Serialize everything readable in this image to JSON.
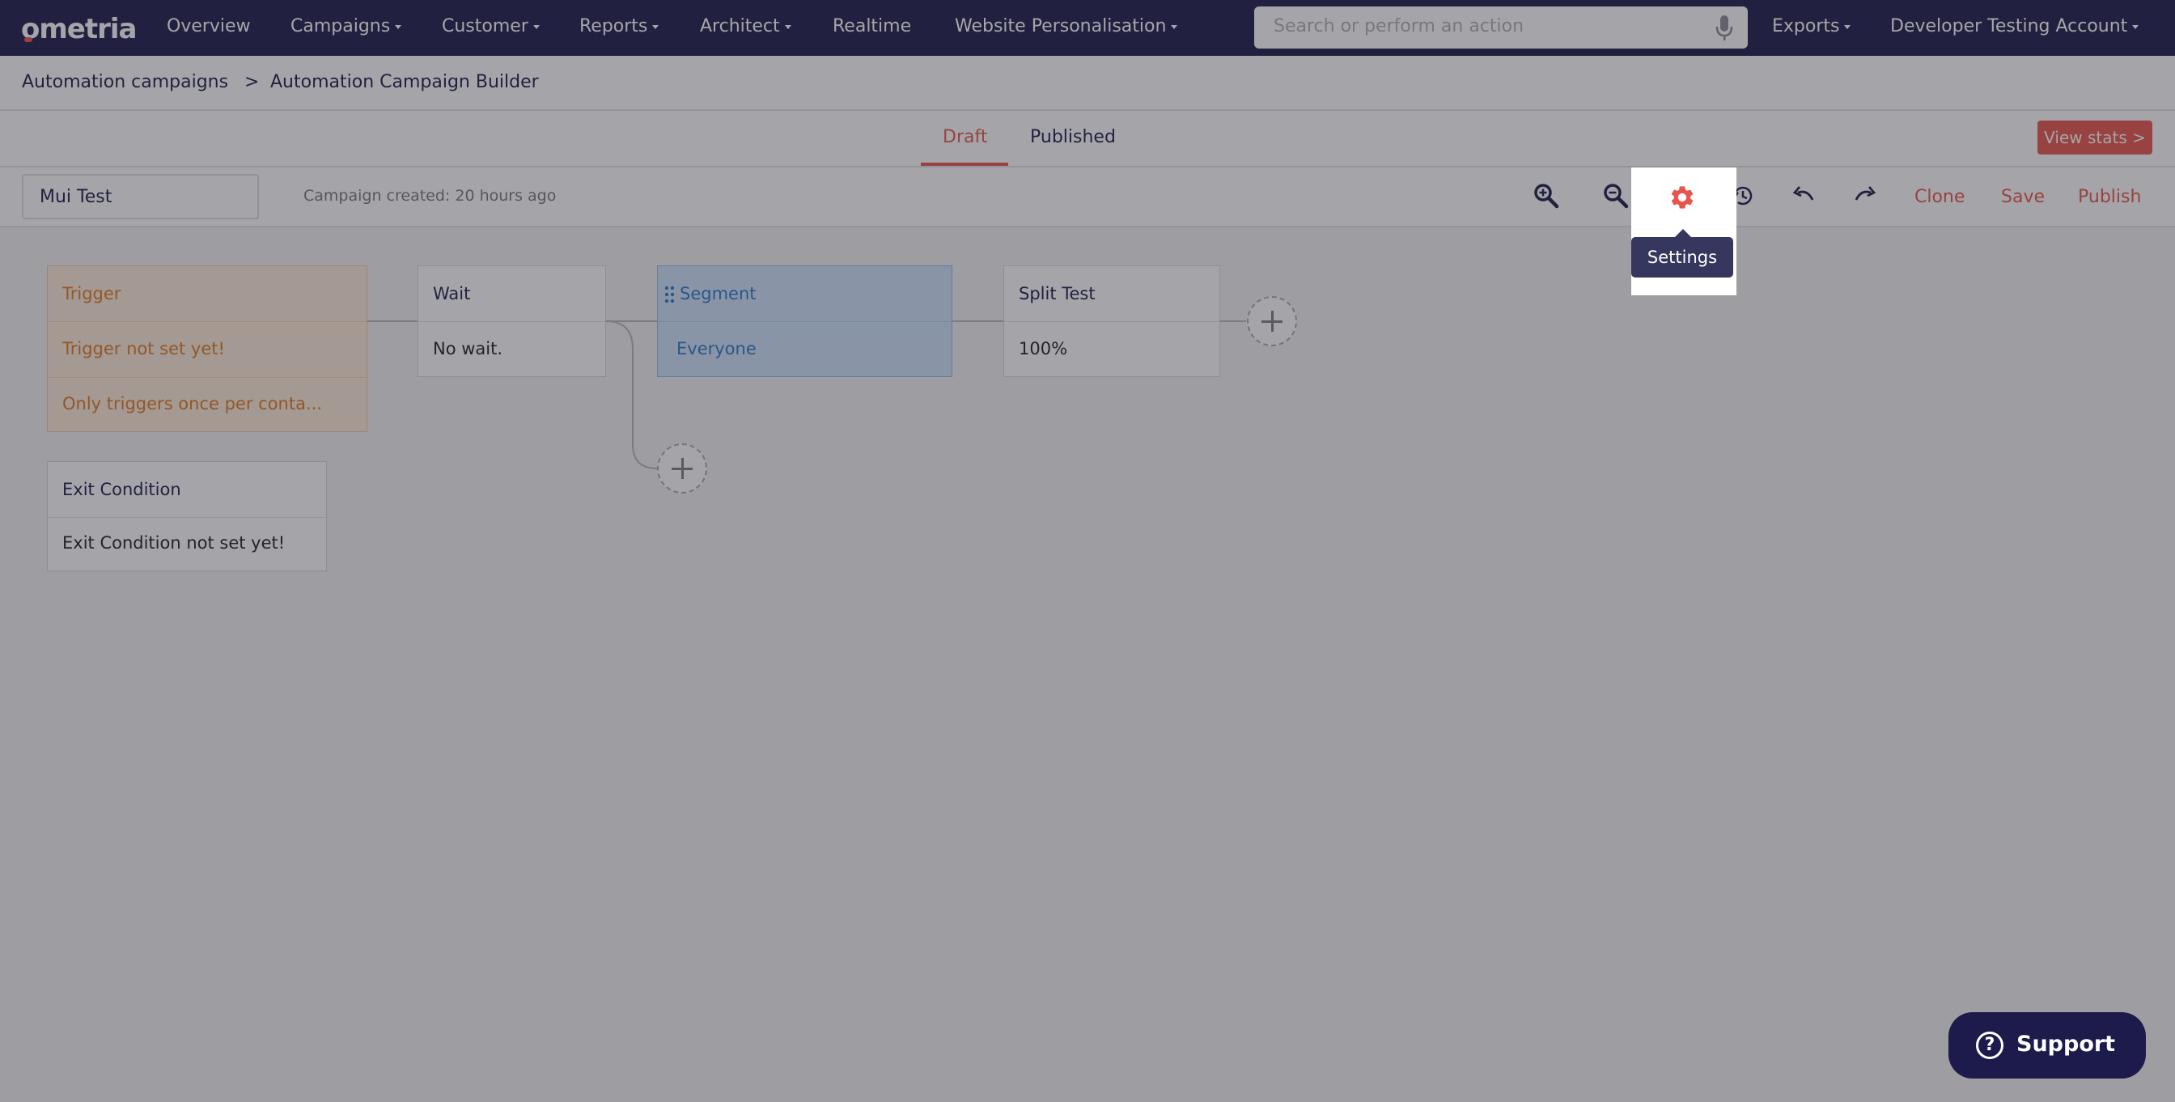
{
  "brand": {
    "logo": "ometria"
  },
  "nav": {
    "items": [
      {
        "label": "Overview"
      },
      {
        "label": "Campaigns"
      },
      {
        "label": "Customer"
      },
      {
        "label": "Reports"
      },
      {
        "label": "Architect"
      },
      {
        "label": "Realtime"
      },
      {
        "label": "Website Personalisation"
      }
    ],
    "search_placeholder": "Search or perform an action",
    "exports": "Exports",
    "account": "Developer Testing Account"
  },
  "breadcrumb": {
    "items": [
      "Automation campaigns",
      "Automation Campaign Builder"
    ],
    "separator": ">"
  },
  "tabs": [
    {
      "label": "Draft",
      "active": true
    },
    {
      "label": "Published",
      "active": false
    }
  ],
  "view_stats": "View stats >",
  "toolbar": {
    "campaign_name": "Mui Test",
    "created": "Campaign created: 20 hours ago",
    "clone": "Clone",
    "save": "Save",
    "publish": "Publish",
    "tooltip": "Settings"
  },
  "nodes": {
    "trigger": {
      "title": "Trigger",
      "rows": [
        "Trigger not set yet!",
        "Only triggers once per conta..."
      ]
    },
    "wait": {
      "title": "Wait",
      "rows": [
        "No wait."
      ]
    },
    "segment": {
      "title": "Segment",
      "rows": [
        "Everyone"
      ]
    },
    "split_test": {
      "title": "Split Test",
      "rows": [
        "100%"
      ]
    },
    "exit_condition": {
      "title": "Exit Condition",
      "rows": [
        "Exit Condition not set yet!"
      ]
    }
  },
  "support": {
    "label": "Support",
    "icon": "?"
  },
  "colors": {
    "nav_bg": "#1c1b4b",
    "accent": "#e8554d",
    "trigger_bg": "#fdebd9",
    "trigger_text": "#e07a22",
    "segment_bg": "#cfe4fb",
    "segment_text": "#2b77c7",
    "tooltip_bg": "#36375e"
  }
}
